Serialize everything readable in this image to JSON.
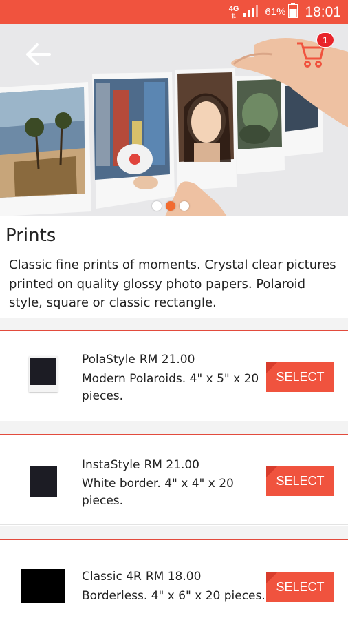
{
  "status_bar": {
    "network": "4G",
    "battery_percent": "61%",
    "time": "18:01"
  },
  "header": {
    "back_icon": "arrow-left-icon",
    "cart_icon": "cart-icon",
    "cart_count": "1"
  },
  "carousel": {
    "page_count": 3,
    "active_index": 1
  },
  "page": {
    "title": "Prints",
    "description": "Classic fine prints of moments. Crystal clear pictures printed on quality glossy photo papers. Polaroid style, square or classic rectangle."
  },
  "products": [
    {
      "name": "PolaStyle",
      "price": "RM 21.00",
      "description": "Modern Polaroids. 4\" x 5\" x 20 pieces.",
      "button": "SELECT"
    },
    {
      "name": "InstaStyle",
      "price": "RM 21.00",
      "description": "White border. 4\" x 4\" x 20 pieces.",
      "button": "SELECT"
    },
    {
      "name": "Classic 4R",
      "price": "RM 18.00",
      "description": "Borderless. 4\" x 6\" x 20 pieces.",
      "button": "SELECT"
    }
  ],
  "colors": {
    "accent": "#f0533e",
    "badge": "#e8242a",
    "dot_active": "#f26b2f"
  }
}
